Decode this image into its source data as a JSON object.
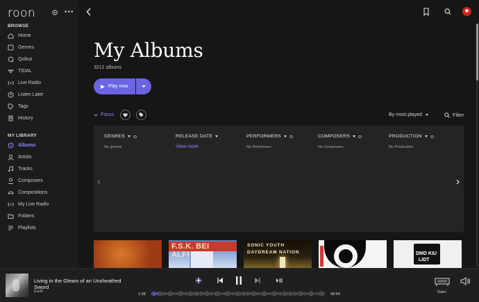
{
  "app": {
    "logo": "roon"
  },
  "sidebar": {
    "browse_title": "BROWSE",
    "browse_items": [
      {
        "label": "Home",
        "icon": "home-icon"
      },
      {
        "label": "Genres",
        "icon": "genres-icon"
      },
      {
        "label": "Qobuz",
        "icon": "qobuz-icon"
      },
      {
        "label": "TIDAL",
        "icon": "tidal-icon"
      },
      {
        "label": "Live Radio",
        "icon": "radio-icon"
      },
      {
        "label": "Listen Later",
        "icon": "clock-icon"
      },
      {
        "label": "Tags",
        "icon": "tag-icon"
      },
      {
        "label": "History",
        "icon": "history-icon"
      }
    ],
    "library_title": "MY LIBRARY",
    "library_items": [
      {
        "label": "Albums",
        "icon": "album-icon",
        "active": true
      },
      {
        "label": "Artists",
        "icon": "artist-icon"
      },
      {
        "label": "Tracks",
        "icon": "note-icon"
      },
      {
        "label": "Composers",
        "icon": "composer-icon"
      },
      {
        "label": "Compositions",
        "icon": "composition-icon"
      },
      {
        "label": "My Live Radio",
        "icon": "radio-icon"
      },
      {
        "label": "Folders",
        "icon": "folder-icon"
      },
      {
        "label": "Playlists",
        "icon": "playlist-icon"
      }
    ]
  },
  "main": {
    "title": "My Albums",
    "count": "3212 albums",
    "play_label": "Play now",
    "focus_label": "Focus",
    "sort_label": "By most played",
    "filter_label": "Filter"
  },
  "focus_panel": {
    "columns": [
      {
        "header": "GENRES",
        "value": "No genres"
      },
      {
        "header": "RELEASE DATE",
        "link": "View more"
      },
      {
        "header": "PERFORMERS",
        "value": "No Performers"
      },
      {
        "header": "COMPOSERS",
        "value": "No Composers"
      },
      {
        "header": "PRODUCTION",
        "value": "No Production"
      }
    ]
  },
  "albums": [
    {
      "art_text": []
    },
    {
      "art_text": [
        "F.S.K. BEI ALFRED"
      ]
    },
    {
      "art_text": [
        "SONIC YOUTH",
        "DAYDREAM NATION"
      ]
    },
    {
      "art_text": []
    },
    {
      "art_text": [
        "DMD KIU",
        "LIDT"
      ]
    }
  ],
  "player": {
    "track": "Living in the Gleam of an Unsheathed Sword",
    "artist": "Earth",
    "elapsed": "1:58",
    "duration": "58:54",
    "zone": "Naim",
    "progress": 0.034
  },
  "colors": {
    "accent": "#6c65e3",
    "link": "#8f8bff",
    "avatar": "#c8261e"
  }
}
